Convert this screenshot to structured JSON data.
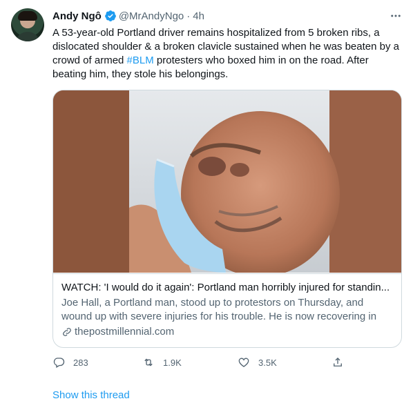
{
  "author": {
    "name": "Andy Ngô",
    "handle": "@MrAndyNgo",
    "separator": "·",
    "time": "4h"
  },
  "tweet": {
    "text_before_hashtag": "A 53-year-old Portland driver remains hospitalized from 5 broken ribs, a dislocated shoulder & a broken clavicle sustained when he was beaten by a crowd of armed ",
    "hashtag": "#BLM",
    "text_after_hashtag": " protesters who boxed him in on the road. After beating him, they stole his belongings."
  },
  "card": {
    "title": "WATCH: 'I would do it again': Portland man horribly injured for standin...",
    "description": "Joe Hall, a Portland man, stood up to protestors on Thursday, and wound up with severe injuries for his trouble. He is now recovering in hospital ...",
    "domain": "thepostmillennial.com"
  },
  "actions": {
    "replies": "283",
    "retweets": "1.9K",
    "likes": "3.5K"
  },
  "show_thread": "Show this thread",
  "colors": {
    "accent": "#1d9bf0",
    "secondary_text": "#536471",
    "border": "#cfd9de"
  },
  "icons": [
    "verified-badge-icon",
    "more-icon",
    "link-icon",
    "reply-icon",
    "retweet-icon",
    "like-icon",
    "share-icon"
  ]
}
